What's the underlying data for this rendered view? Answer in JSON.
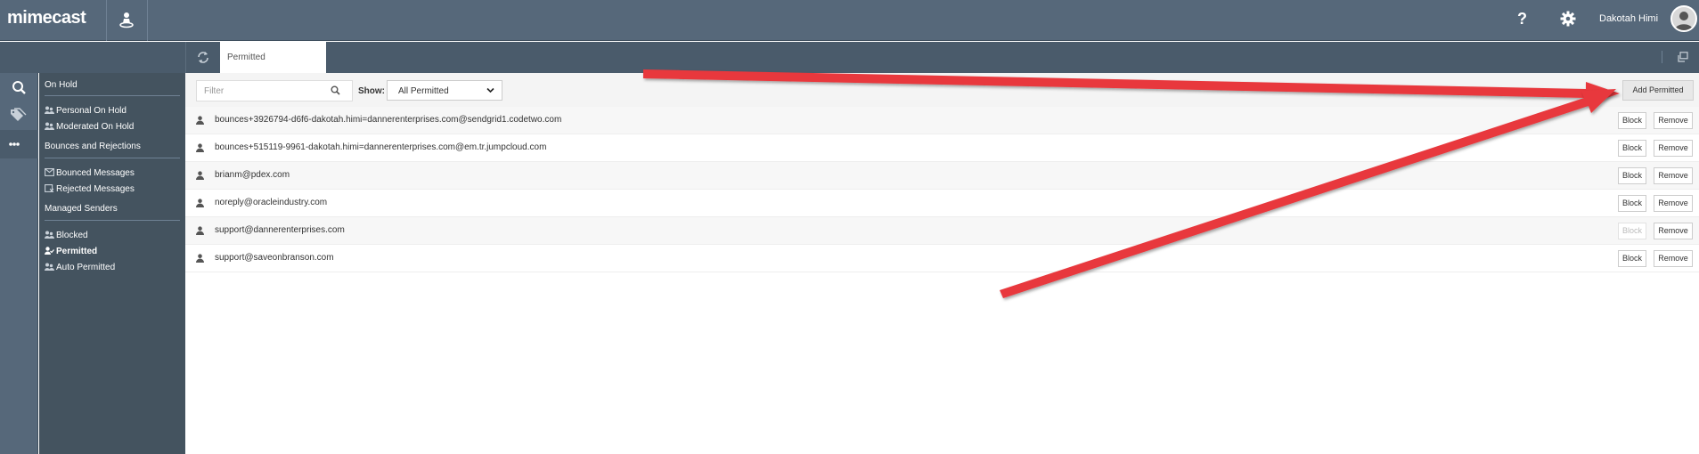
{
  "header": {
    "logo": "mimecast",
    "help_label": "?",
    "user_name": "Dakotah Himi",
    "icons": [
      "app-switcher-icon",
      "help-icon",
      "gear-icon",
      "avatar"
    ]
  },
  "tabs": [
    {
      "label": "Permitted",
      "active": true
    }
  ],
  "rail": {
    "items": [
      "search-icon",
      "tags-icon",
      "more-icon"
    ],
    "active_index": 2
  },
  "menu": {
    "on_hold": "On Hold",
    "personal_on_hold": "Personal On Hold",
    "moderated_on_hold": "Moderated On Hold",
    "bounces_and_rejections": "Bounces and Rejections",
    "bounced_messages": "Bounced Messages",
    "rejected_messages": "Rejected Messages",
    "managed_senders": "Managed Senders",
    "blocked": "Blocked",
    "permitted": "Permitted",
    "auto_permitted": "Auto Permitted",
    "active": "Permitted"
  },
  "toolbar": {
    "filter_placeholder": "Filter",
    "show_label": "Show:",
    "show_value": "All Permitted",
    "add_button": "Add Permitted"
  },
  "rows": [
    {
      "email": "bounces+3926794-d6f6-dakotah.himi=dannerenterprises.com@sendgrid1.codetwo.com",
      "block": "Block",
      "remove": "Remove",
      "block_enabled": true
    },
    {
      "email": "bounces+515119-9961-dakotah.himi=dannerenterprises.com@em.tr.jumpcloud.com",
      "block": "Block",
      "remove": "Remove",
      "block_enabled": true
    },
    {
      "email": "brianm@pdex.com",
      "block": "Block",
      "remove": "Remove",
      "block_enabled": true
    },
    {
      "email": "noreply@oracleindustry.com",
      "block": "Block",
      "remove": "Remove",
      "block_enabled": true
    },
    {
      "email": "support@dannerenterprises.com",
      "block": "Block",
      "remove": "Remove",
      "block_enabled": false
    },
    {
      "email": "support@saveonbranson.com",
      "block": "Block",
      "remove": "Remove",
      "block_enabled": true
    }
  ],
  "colors": {
    "header_bg": "#56687a",
    "sidebar_bg": "#44535f",
    "arrow": "#e8383d"
  }
}
